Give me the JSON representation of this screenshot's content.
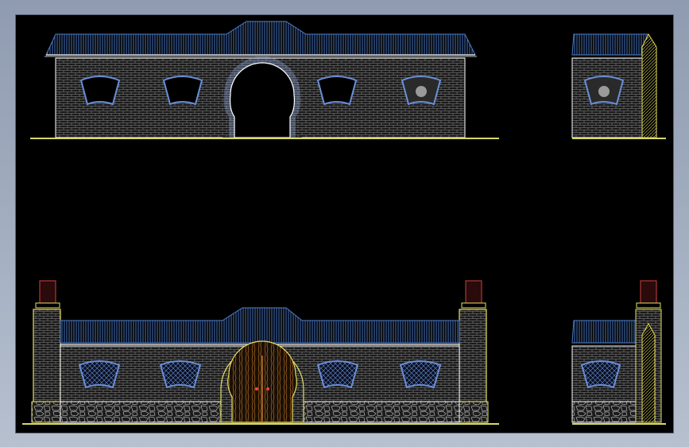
{
  "drawing": {
    "background": "#000000",
    "frame_color": "#a6b1c3",
    "colors": {
      "brick": "#9a9a9a",
      "roof": "#4f7fd0",
      "fan_window": "#6a8fd8",
      "ground": "#d8d86a",
      "door": "#c87c2c",
      "lantern": "#d04040",
      "pillar_trim": "#e8e060",
      "wall_line": "#ffffff"
    },
    "views": [
      {
        "id": "upper-front-elevation",
        "windows": 4,
        "gate": "moon-gate-open"
      },
      {
        "id": "upper-side-elevation",
        "windows": 1
      },
      {
        "id": "lower-front-elevation",
        "windows": 4,
        "gate": "moon-gate-with-door",
        "pillars": 2
      },
      {
        "id": "lower-side-elevation",
        "windows": 1,
        "pillars": 1
      }
    ]
  }
}
